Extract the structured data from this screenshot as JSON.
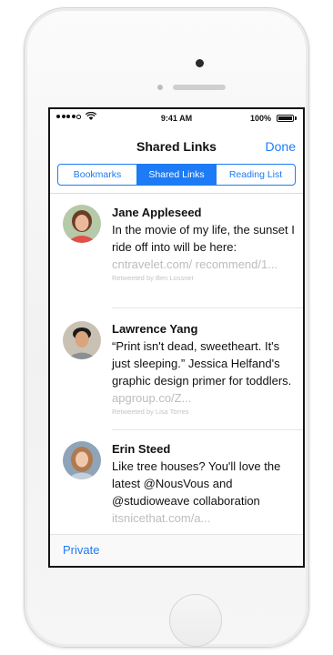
{
  "status_bar": {
    "time": "9:41 AM",
    "battery": "100%"
  },
  "nav": {
    "title": "Shared Links",
    "done_label": "Done"
  },
  "segments": [
    {
      "label": "Bookmarks",
      "active": false
    },
    {
      "label": "Shared Links",
      "active": true
    },
    {
      "label": "Reading List",
      "active": false
    }
  ],
  "posts": [
    {
      "name": "Jane Appleseed",
      "text": "In the movie of my life, the sunset I ride off into will be here:",
      "link": "cntravelet.com/ recommend/1...",
      "retweet": "Retweeted by Ben Lossner"
    },
    {
      "name": "Lawrence Yang",
      "text": "“Print isn't dead, sweetheart. It's just sleeping.” Jessica Helfand's graphic design primer for toddlers.",
      "link": "apgroup.co/Z...",
      "retweet": "Retweeted by Lisa Torres"
    },
    {
      "name": "Erin Steed",
      "text": "Like tree houses? You'll love the latest @NousVous and @studioweave collaboration",
      "link": "itsnicethat.com/a...",
      "retweet": ""
    }
  ],
  "toolbar": {
    "private_label": "Private"
  },
  "colors": {
    "accent": "#1d7bf5",
    "link_gray": "#bdbdbd",
    "bezel": "#f4f4f4"
  }
}
